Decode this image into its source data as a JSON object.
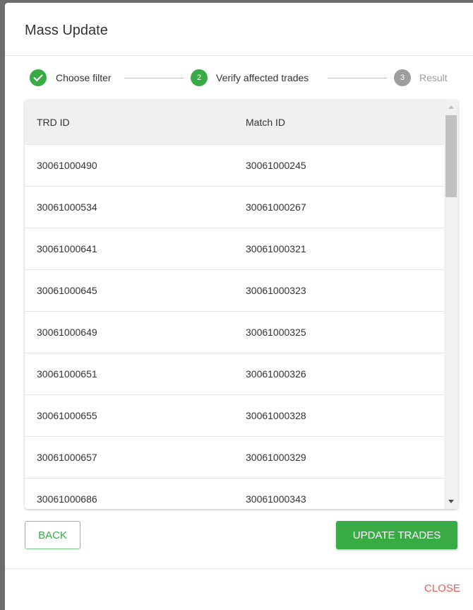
{
  "dialog": {
    "title": "Mass Update"
  },
  "stepper": {
    "steps": [
      {
        "label": "Choose filter",
        "number": "",
        "state": "done"
      },
      {
        "label": "Verify affected trades",
        "number": "2",
        "state": "active"
      },
      {
        "label": "Result",
        "number": "3",
        "state": "inactive"
      }
    ]
  },
  "table": {
    "columns": [
      "TRD ID",
      "Match ID"
    ],
    "rows": [
      [
        "30061000490",
        "30061000245"
      ],
      [
        "30061000534",
        "30061000267"
      ],
      [
        "30061000641",
        "30061000321"
      ],
      [
        "30061000645",
        "30061000323"
      ],
      [
        "30061000649",
        "30061000325"
      ],
      [
        "30061000651",
        "30061000326"
      ],
      [
        "30061000655",
        "30061000328"
      ],
      [
        "30061000657",
        "30061000329"
      ],
      [
        "30061000686",
        "30061000343"
      ]
    ]
  },
  "actions": {
    "back_label": "BACK",
    "update_label": "UPDATE TRADES",
    "close_label": "CLOSE"
  },
  "colors": {
    "green": "#39ab44",
    "grey_step": "#9e9e9e",
    "close_red": "#f05a5a"
  }
}
